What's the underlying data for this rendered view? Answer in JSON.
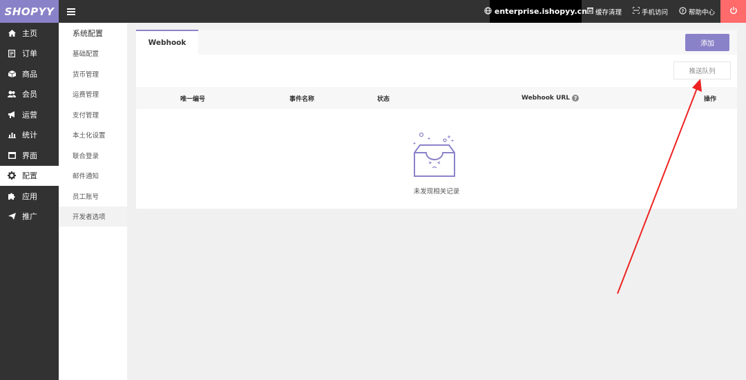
{
  "topbar": {
    "logo": "SHOPYY",
    "menu_icon": "menu-icon",
    "domain": "enterprise.ishopyy.cn",
    "cache_clear": "缓存清理",
    "mobile_visit": "手机访问",
    "help_center": "帮助中心"
  },
  "sidebar": {
    "items": [
      {
        "label": "主页",
        "icon": "home-icon"
      },
      {
        "label": "订单",
        "icon": "order-icon"
      },
      {
        "label": "商品",
        "icon": "box-icon"
      },
      {
        "label": "会员",
        "icon": "users-icon"
      },
      {
        "label": "运营",
        "icon": "megaphone-icon"
      },
      {
        "label": "统计",
        "icon": "chart-icon"
      },
      {
        "label": "界面",
        "icon": "window-icon"
      },
      {
        "label": "配置",
        "icon": "gear-icon"
      },
      {
        "label": "应用",
        "icon": "puzzle-icon"
      },
      {
        "label": "推广",
        "icon": "send-icon"
      }
    ],
    "active_index": 7
  },
  "subnav": {
    "title": "系统配置",
    "items": [
      "基础配置",
      "货币管理",
      "运费管理",
      "支付管理",
      "本土化设置",
      "联合登录",
      "邮件通知",
      "员工账号",
      "开发者选项"
    ]
  },
  "main": {
    "tab": "Webhook",
    "add_button": "添加",
    "push_queue_button": "推送队列",
    "columns": [
      "唯一编号",
      "事件名称",
      "状态",
      "Webhook URL",
      "操作"
    ],
    "empty_text": "未发现相关记录"
  },
  "colors": {
    "accent": "#8a82c8",
    "dark": "#323232",
    "power": "#ff6b6b",
    "arrow": "#ee2222"
  }
}
